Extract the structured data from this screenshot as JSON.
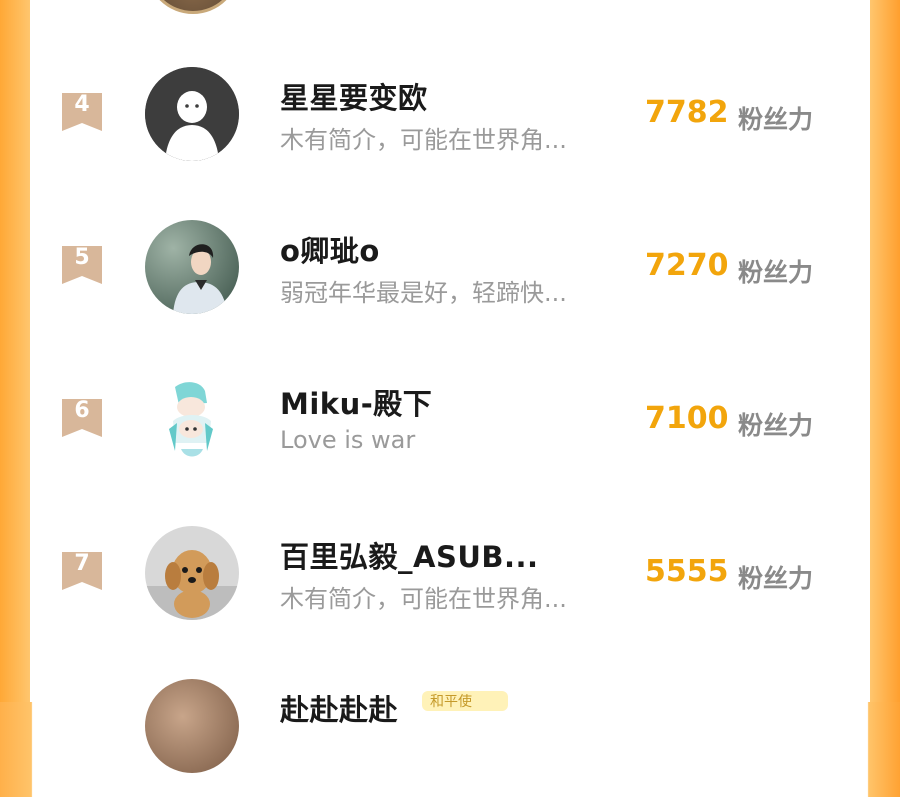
{
  "leaderboard": {
    "unit_label": "粉丝力",
    "rows": [
      {
        "rank": "4",
        "name": "星星要变欧",
        "bio": "木有简介，可能在世界角...",
        "score": "7782"
      },
      {
        "rank": "5",
        "name": "o卿玼o",
        "bio": "弱冠年华最是好，轻蹄快...",
        "score": "7270"
      },
      {
        "rank": "6",
        "name": "Miku-殿下",
        "bio": "Love is war",
        "score": "7100"
      },
      {
        "rank": "7",
        "name": "百里弘毅_ASUB...",
        "bio": "木有简介，可能在世界角...",
        "score": "5555"
      }
    ],
    "partial_row": {
      "name": "赴赴赴赴",
      "badge": "和平使"
    }
  },
  "colors": {
    "accent_score": "#f2a50c",
    "rank_badge": "#d8b79a",
    "side_rail": "#ffa836"
  },
  "icons": {
    "rank_badge": "bookmark-ribbon-icon",
    "default_avatar": "default-user-avatar-icon"
  }
}
